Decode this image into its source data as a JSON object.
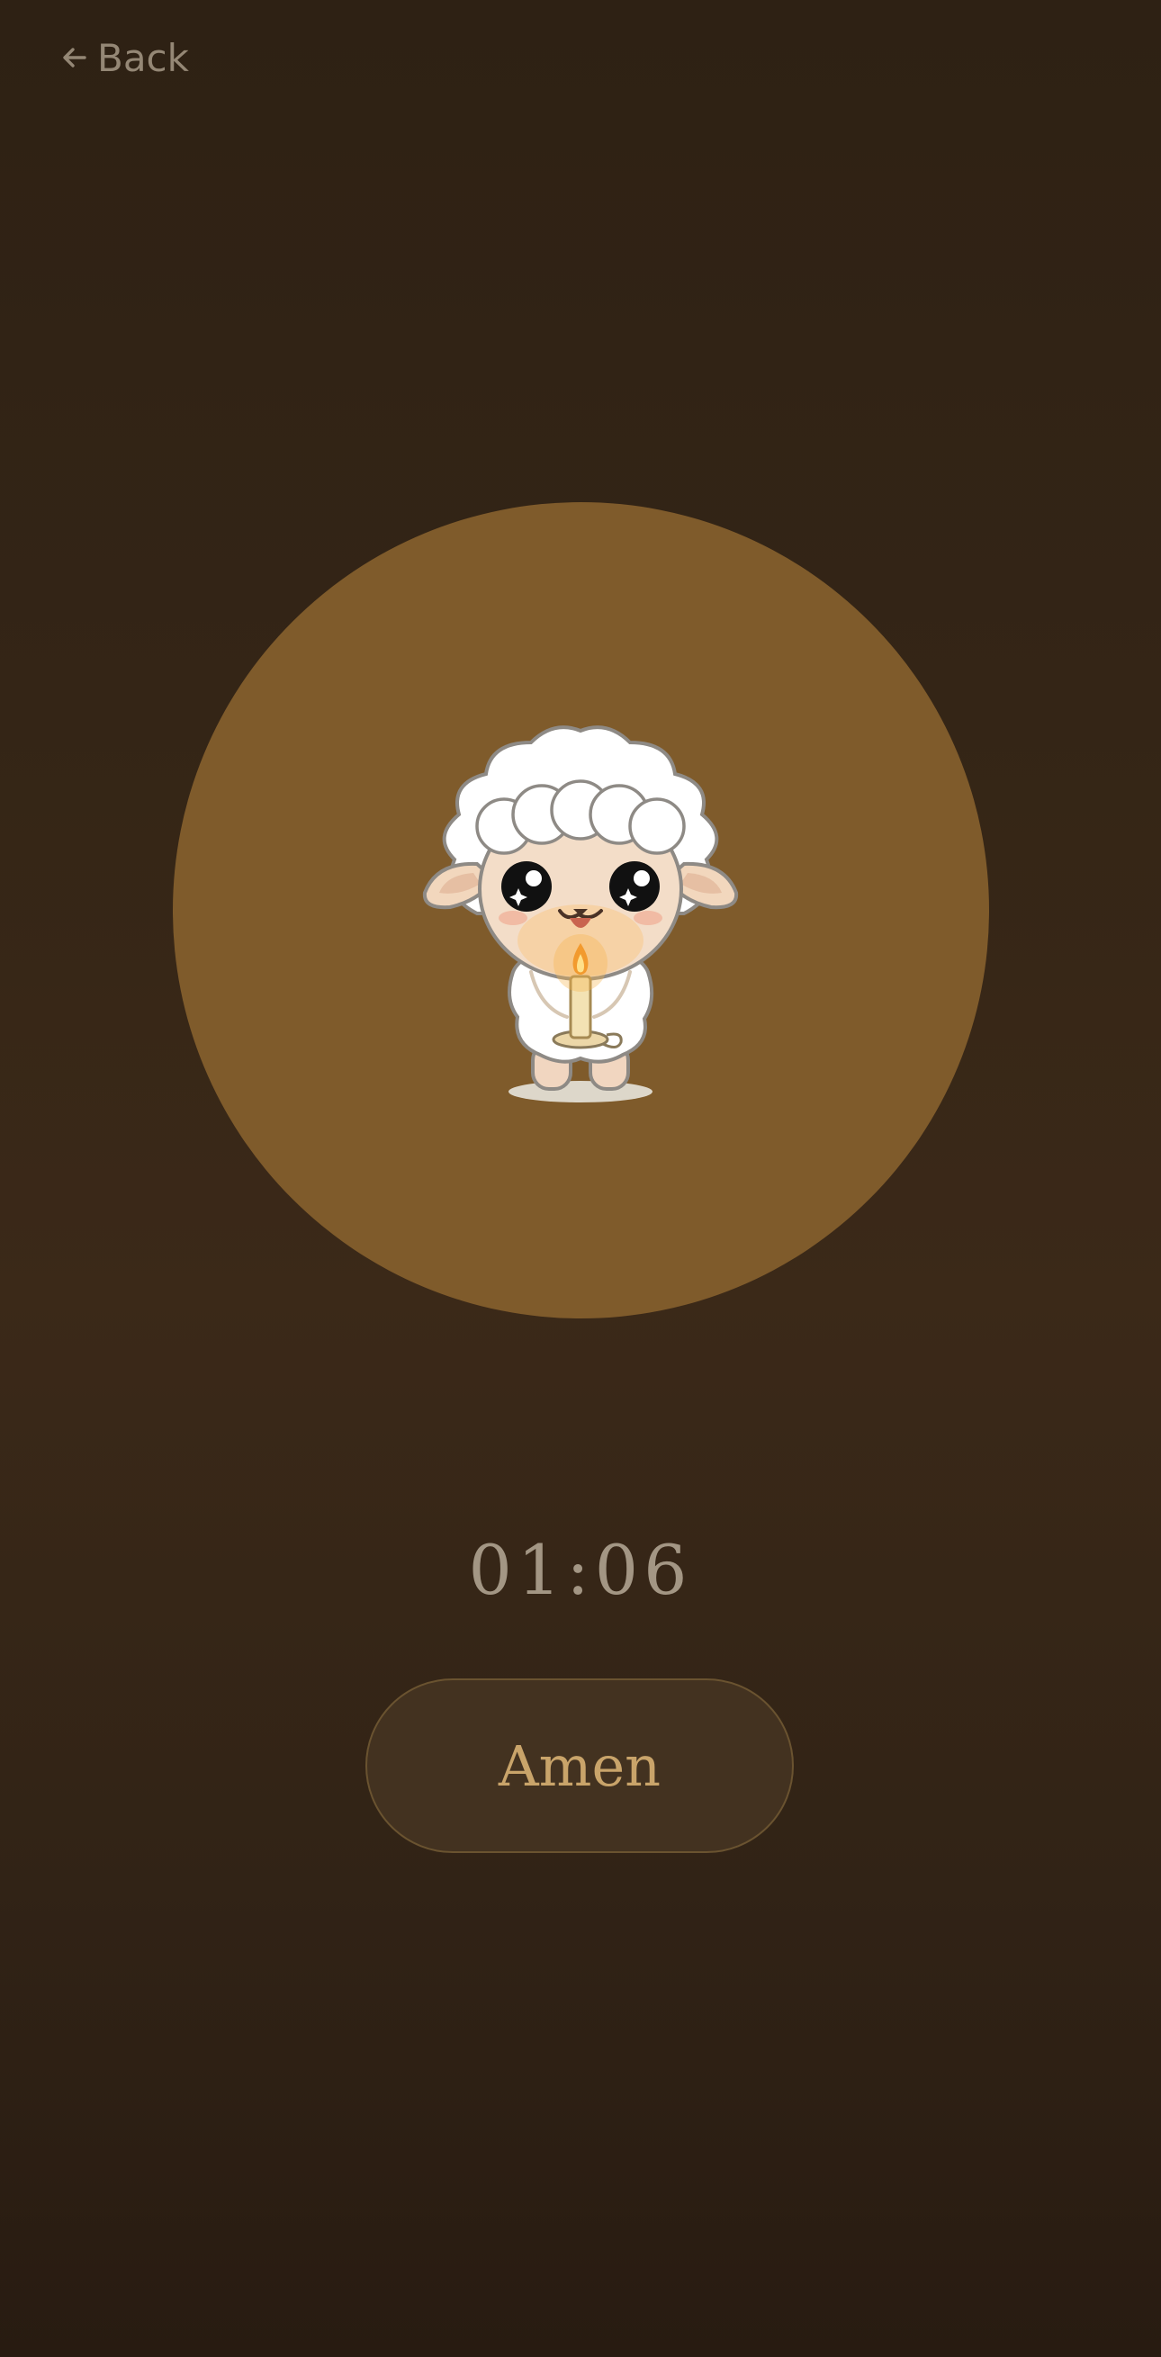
{
  "nav": {
    "back_label": "Back",
    "back_icon": "arrow-left-icon"
  },
  "illustration": {
    "subject": "sheep-holding-candle",
    "circle_color": "#7f5b2b"
  },
  "timer": {
    "value": "01:06"
  },
  "actions": {
    "amen_label": "Amen"
  },
  "colors": {
    "background": "#342516",
    "accent": "#c9a46a",
    "muted_text": "#a39684"
  }
}
